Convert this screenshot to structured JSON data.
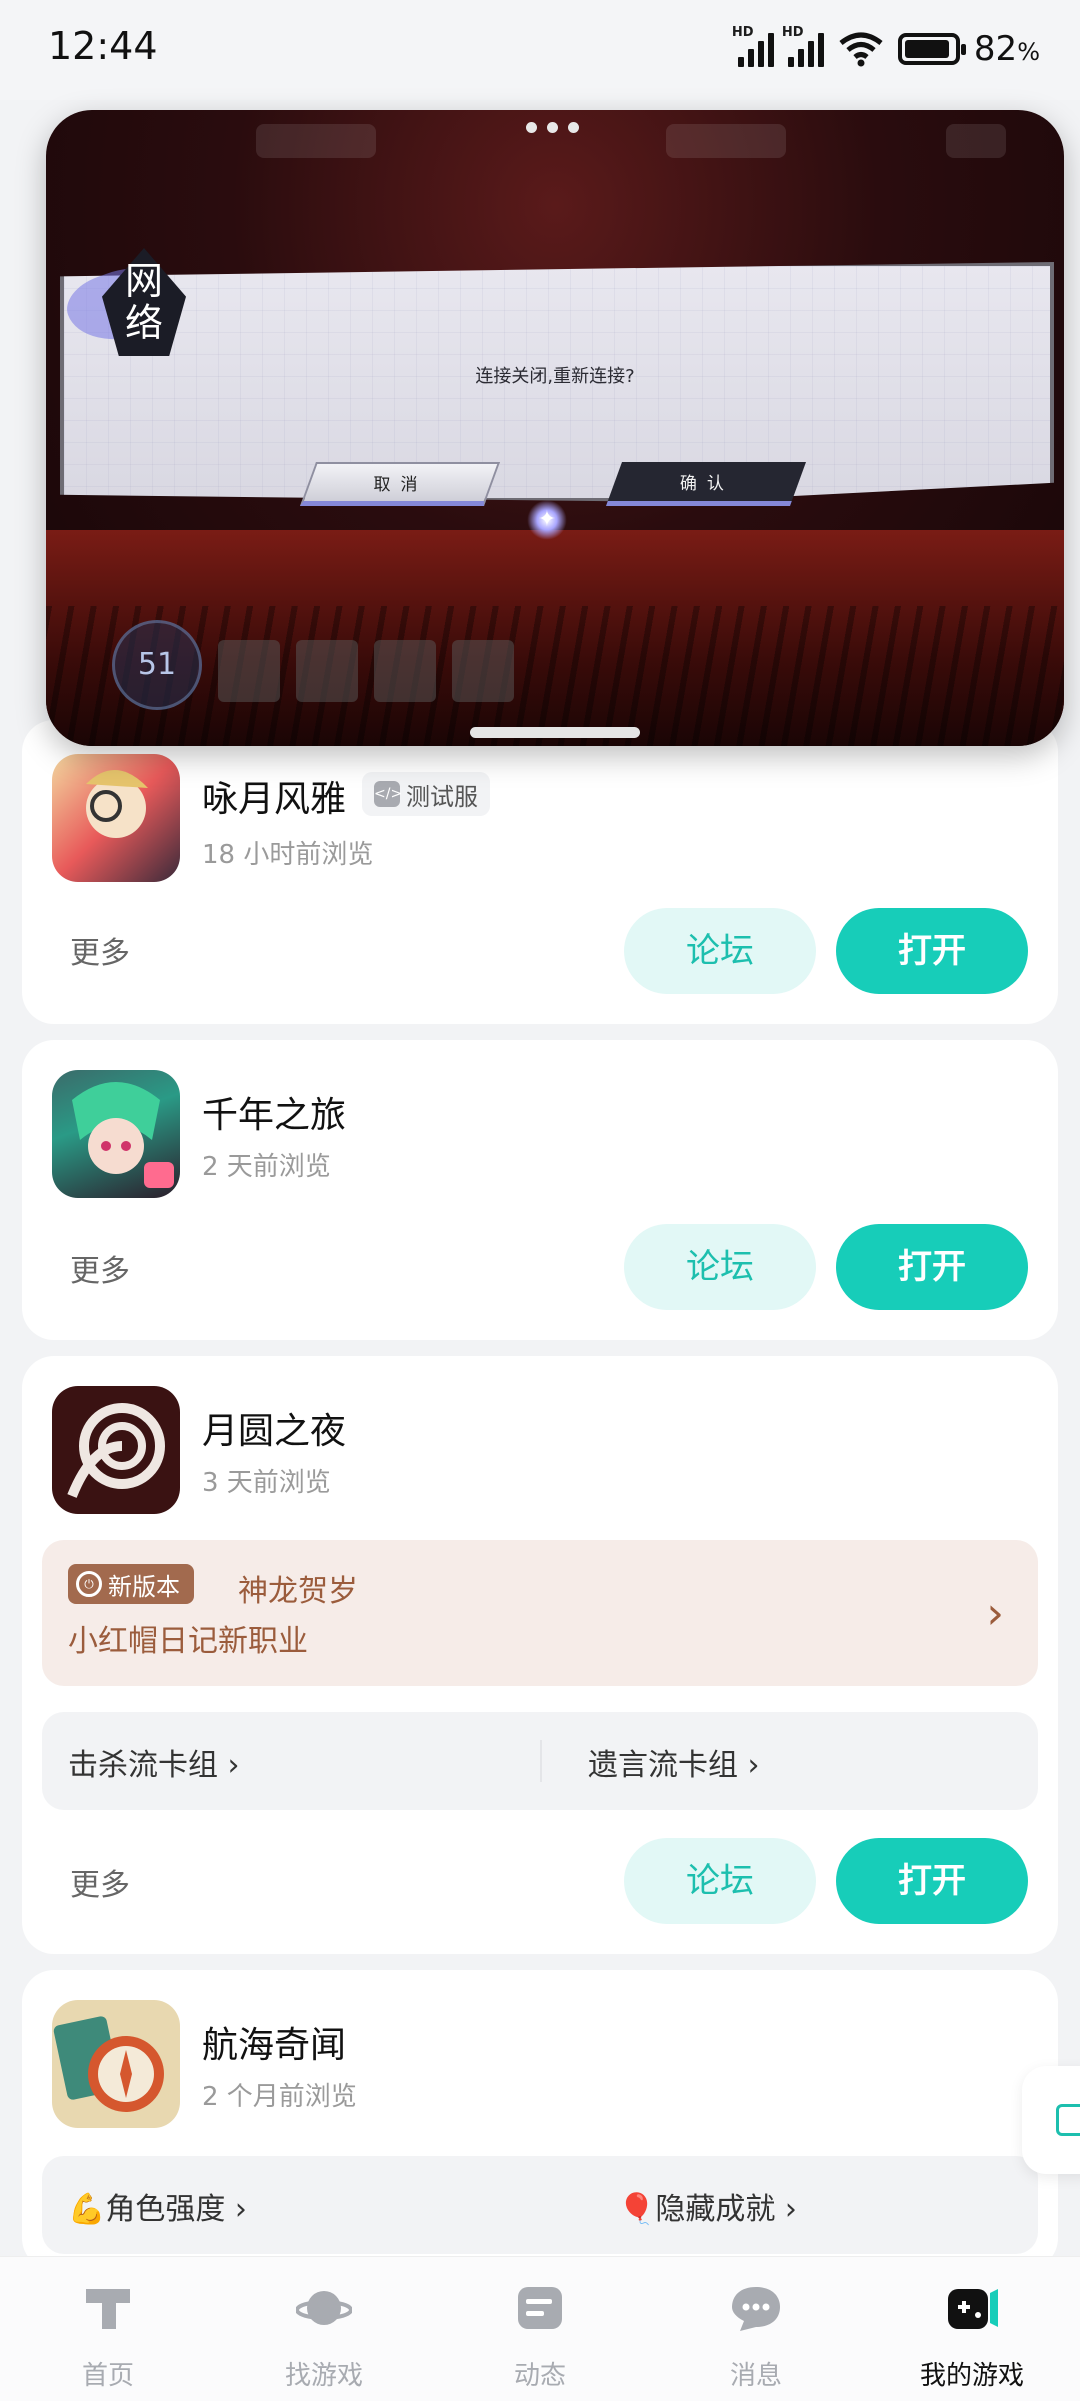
{
  "status_bar": {
    "time": "12:44",
    "battery": "82",
    "battery_unit": "%",
    "network_label": "HD"
  },
  "game_popup": {
    "dialog_tag": "网络",
    "dialog_message": "连接关闭,重新连接?",
    "cancel_label": "取消",
    "confirm_label": "确认",
    "hud_level": "51"
  },
  "games": [
    {
      "title": "咏月风雅",
      "badge": "测试服",
      "last_viewed": "18 小时前浏览",
      "more": "更多",
      "forum": "论坛",
      "open": "打开"
    },
    {
      "title": "千年之旅",
      "last_viewed": "2 天前浏览",
      "more": "更多",
      "forum": "论坛",
      "open": "打开"
    },
    {
      "title": "月圆之夜",
      "last_viewed": "3 天前浏览",
      "news": {
        "badge": "新版本",
        "headline": "神龙贺岁",
        "body": "小红帽日记新职业"
      },
      "links": [
        "击杀流卡组 ›",
        "遗言流卡组 ›"
      ],
      "more": "更多",
      "forum": "论坛",
      "open": "打开"
    },
    {
      "title": "航海奇闻",
      "last_viewed": "2 个月前浏览",
      "links": [
        "💪角色强度 ›",
        "🎈隐藏成就 ›"
      ]
    }
  ],
  "bottom_nav": [
    {
      "label": "首页",
      "icon": "home-icon"
    },
    {
      "label": "找游戏",
      "icon": "planet-icon"
    },
    {
      "label": "动态",
      "icon": "feed-icon"
    },
    {
      "label": "消息",
      "icon": "chat-icon"
    },
    {
      "label": "我的游戏",
      "icon": "gamepad-icon",
      "active": true
    }
  ],
  "colors": {
    "accent": "#17cdb9",
    "forum_bg": "#e2f8f6",
    "news_text": "#9b5c3c",
    "page_bg": "#f2f3f5"
  }
}
